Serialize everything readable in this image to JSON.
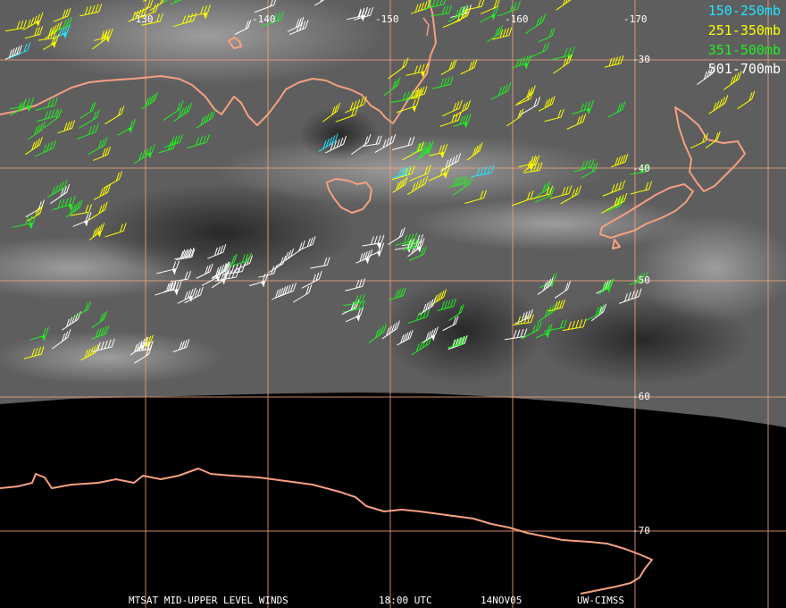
{
  "map": {
    "longitude_labels": [
      "-130",
      "-140",
      "-150",
      "-160",
      "-170"
    ],
    "latitude_labels": [
      "-30",
      "-40",
      "-50",
      "-60",
      "-70"
    ],
    "legend": [
      {
        "label": "150-250mb",
        "color": "#22e5ff"
      },
      {
        "label": "251-350mb",
        "color": "#ffff00"
      },
      {
        "label": "351-500mb",
        "color": "#22ee22"
      },
      {
        "label": "501-700mb",
        "color": "#ffffff"
      }
    ],
    "footer": {
      "product": "MTSAT MID-UPPER LEVEL WINDS",
      "time": "18:00 UTC",
      "date": "14NOV05",
      "source": "UW-CIMSS"
    },
    "colors": {
      "gridline": "#f0a07a",
      "coastline": "#f5a080",
      "background": "#000000",
      "imagery": "#5a5a5a"
    }
  }
}
